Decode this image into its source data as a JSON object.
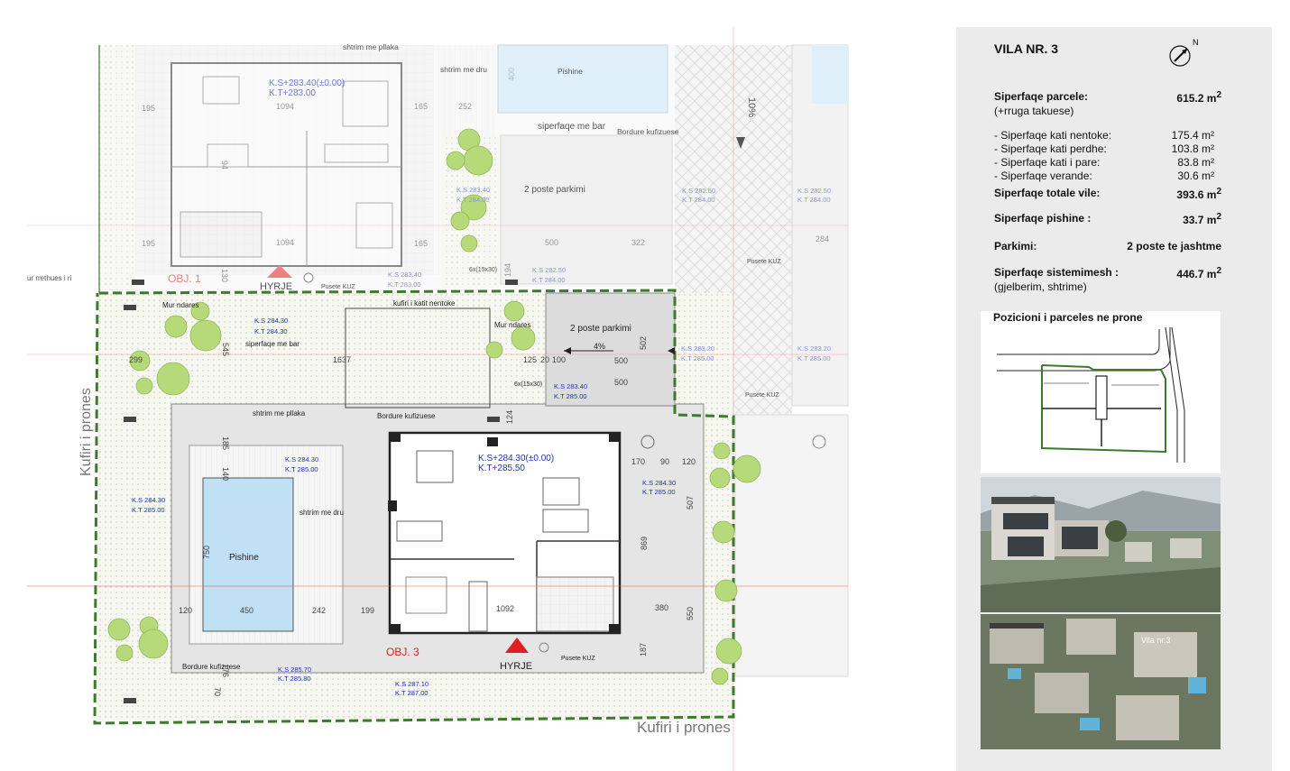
{
  "plan": {
    "top_labels": [
      "shtrim me pllaka",
      "shtrim me dru",
      "Pishine",
      "siperfaqe me bar",
      "Bordure kufizuese",
      "2 poste parkimi"
    ],
    "slope_label": "10%",
    "boundary_label_left": "Kufiri i prones",
    "boundary_label_bottom": "Kufiri i prones",
    "left_fence_label": "ur rrethues i ri",
    "obj1": {
      "name": "OBJ. 1",
      "entrance": "HYRJE",
      "ks": "K.S+283.40(±0.00)",
      "kt": "K.T+283.00",
      "dims": [
        "1094",
        "195",
        "165",
        "1094",
        "195",
        "165",
        "94",
        "130"
      ]
    },
    "obj3": {
      "name": "OBJ. 3",
      "entrance": "HYRJE",
      "ks": "K.S+284.30(±0.00)",
      "kt": "K.T+285.50",
      "dims": [
        "1092",
        "869",
        "170",
        "90",
        "120",
        "507",
        "380",
        "550",
        "187"
      ]
    },
    "labels": {
      "mur_ndares": "Mur ndares",
      "kufiri_kati": "kufiri i katit nentoke",
      "siperfaqe_bar": "siperfaqe me bar",
      "shtrim_pllaka": "shtrim me pllaka",
      "shtrim_dru": "shtrim me dru",
      "bordure": "Bordure kufizuese",
      "pishine": "Pishine",
      "parking": "2 poste parkimi",
      "slope_parking": "4%",
      "pusete": "Pusete KUZ",
      "stairs": "6x(15x30)"
    },
    "levels": {
      "ks_284_30": "K.S 284.30",
      "kt_284_30": "K.T 284.30",
      "ks_284_30b": "K.S 284.30",
      "kt_285": "K.T 285.00",
      "ks_285_70": "K.S 285.70",
      "kt_285_80": "K.T 285.80",
      "ks_287_10": "K.S 287.10",
      "kt_287": "K.T 287.00",
      "ks_283_40": "K.S 283.40",
      "kt_285b": "K.T 285.00",
      "ks_283_20": "K.S 283.20",
      "kt_285c": "K.T 285.00",
      "ks_282_50": "K.S 282.50",
      "kt_284": "K.T 284.00",
      "ks_283_40b": "K.S 283.40",
      "kt_284b": "K.T 284.00",
      "ks_283_40c": "K.S 283.40",
      "kt_283": "K.T 283.00"
    },
    "dims_site": {
      "d1637": "1637",
      "d299": "299",
      "d545": "545",
      "d185": "185",
      "d140": "140",
      "d750": "750",
      "d120": "120",
      "d450": "450",
      "d242": "242",
      "d199": "199",
      "d176": "176",
      "d70": "70",
      "d500a": "500",
      "d500b": "500",
      "d502": "502",
      "d125": "125",
      "d20": "20",
      "d100": "100",
      "d124": "124",
      "d252": "252",
      "d400": "400",
      "d500c": "500",
      "d322": "322",
      "d194": "194",
      "d284": "284"
    }
  },
  "panel": {
    "title": "VILA NR. 3",
    "rows": [
      {
        "label": "Siperfaqe parcele:",
        "sub": "(+rruga takuese)",
        "value": "615.2",
        "unit": "m",
        "sup": "2"
      },
      {
        "label": "Siperfaqe totale vile:",
        "value": "393.6",
        "unit": "m",
        "sup": "2"
      },
      {
        "label": "Siperfaqe pishine :",
        "value": "33.7",
        "unit": "m",
        "sup": "2"
      },
      {
        "label": "Parkimi:",
        "value": "2 poste te jashtme"
      },
      {
        "label": "Siperfaqe sistemimesh :",
        "sub": "(gjelberim, shtrime)",
        "value": "446.7",
        "unit": "m",
        "sup": "2"
      }
    ],
    "items": [
      {
        "label": "- Siperfaqe kati nentoke:",
        "value": "175.4 m²"
      },
      {
        "label": "- Siperfaqe kati perdhe:",
        "value": "103.8 m²"
      },
      {
        "label": "- Siperfaqe kati i pare:",
        "value": "83.8 m²"
      },
      {
        "label": "- Siperfaqe verande:",
        "value": "30.6 m²"
      }
    ],
    "location_title": "Pozicioni i parceles ne prone",
    "render2_label": "Vila nr.3"
  },
  "colors": {
    "boundary": "#3d7a2e",
    "tree": "#b6d97a",
    "water": "#bfe0f5",
    "red_marker": "#e02020",
    "level_text": "#2233bb",
    "panel_bg": "#ebebeb"
  }
}
